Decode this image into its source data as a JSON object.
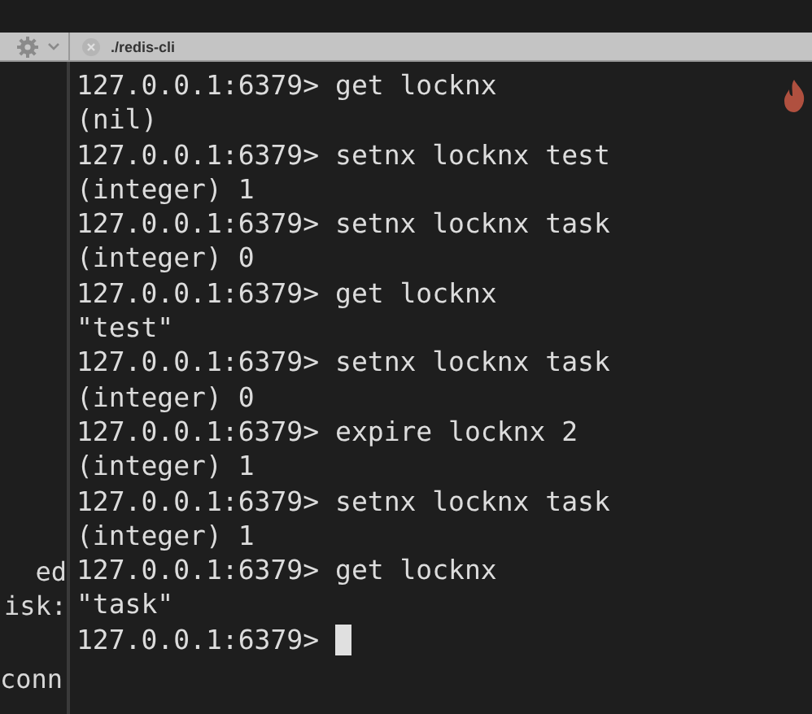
{
  "tab": {
    "title": "./redis-cli"
  },
  "side_pane": {
    "lines": [
      {
        "text": "ed"
      },
      {
        "text": "isk:"
      },
      {
        "text": "conn",
        "gap_before": true
      }
    ]
  },
  "terminal": {
    "lines": [
      {
        "kind": "command",
        "prompt": "127.0.0.1:6379>",
        "command": "get locknx"
      },
      {
        "kind": "output",
        "text": "(nil)"
      },
      {
        "kind": "command",
        "prompt": "127.0.0.1:6379>",
        "command": "setnx locknx test"
      },
      {
        "kind": "output",
        "text": "(integer) 1"
      },
      {
        "kind": "command",
        "prompt": "127.0.0.1:6379>",
        "command": "setnx locknx task"
      },
      {
        "kind": "output",
        "text": "(integer) 0"
      },
      {
        "kind": "command",
        "prompt": "127.0.0.1:6379>",
        "command": "get locknx"
      },
      {
        "kind": "output",
        "text": "\"test\""
      },
      {
        "kind": "command",
        "prompt": "127.0.0.1:6379>",
        "command": "setnx locknx task"
      },
      {
        "kind": "output",
        "text": "(integer) 0"
      },
      {
        "kind": "command",
        "prompt": "127.0.0.1:6379>",
        "command": "expire locknx 2"
      },
      {
        "kind": "output",
        "text": "(integer) 1"
      },
      {
        "kind": "command",
        "prompt": "127.0.0.1:6379>",
        "command": "setnx locknx task"
      },
      {
        "kind": "output",
        "text": "(integer) 1"
      },
      {
        "kind": "command",
        "prompt": "127.0.0.1:6379>",
        "command": "get locknx"
      },
      {
        "kind": "output",
        "text": "\"task\""
      },
      {
        "kind": "command",
        "prompt": "127.0.0.1:6379>",
        "cursor": true
      }
    ]
  }
}
